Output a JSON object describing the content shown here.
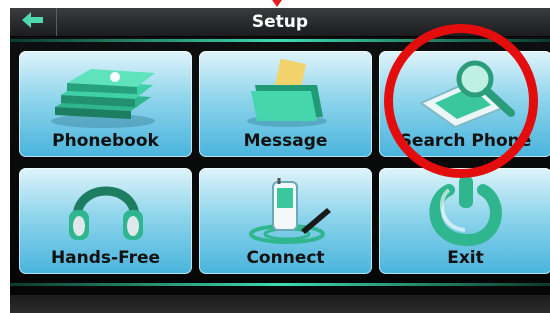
{
  "header": {
    "title": "Setup",
    "back_icon": "back-arrow-icon"
  },
  "tiles": [
    {
      "label": "Phonebook",
      "icon": "phonebook-icon"
    },
    {
      "label": "Message",
      "icon": "message-folder-icon"
    },
    {
      "label": "Search Phone",
      "icon": "search-phone-icon"
    },
    {
      "label": "Hands-Free",
      "icon": "headphones-icon"
    },
    {
      "label": "Connect",
      "icon": "bluetooth-connect-icon"
    },
    {
      "label": "Exit",
      "icon": "exit-icon"
    }
  ],
  "colors": {
    "tile_top": "#dff4fb",
    "tile_bottom": "#49b4dc",
    "accent": "#3fdcb0",
    "highlight": "#e30d0d"
  }
}
